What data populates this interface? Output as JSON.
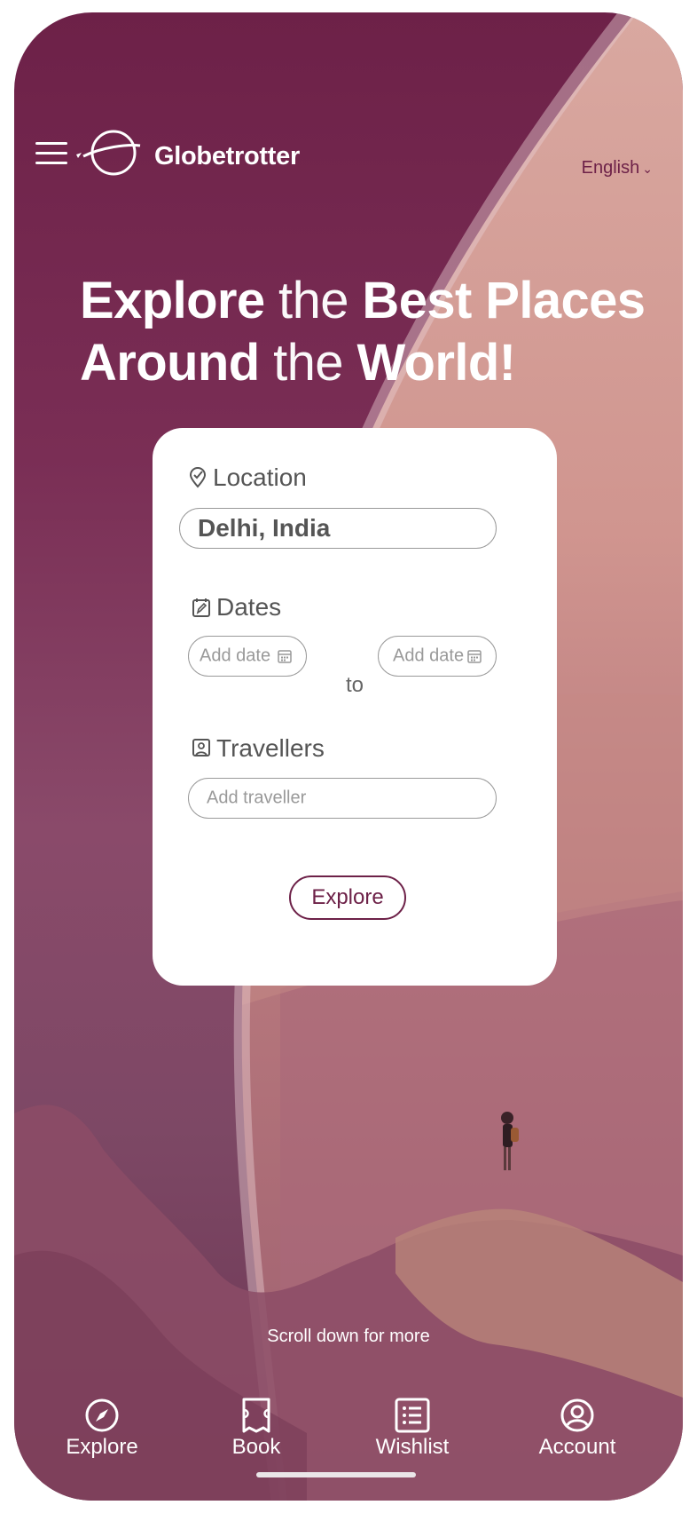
{
  "app": {
    "brand": "Globetrotter",
    "language": "English"
  },
  "hero": {
    "w1": "Explore",
    "w2": " the ",
    "w3": "Best Places",
    "w4": "Around",
    "w5": " the ",
    "w6": "World!"
  },
  "form": {
    "location_label": "Location",
    "location_value": "Delhi, India",
    "dates_label": "Dates",
    "date_from_placeholder": "Add date",
    "date_separator": "to",
    "date_to_placeholder": "Add date",
    "travellers_label": "Travellers",
    "travellers_placeholder": "Add traveller",
    "submit_label": "Explore"
  },
  "scroll_hint": "Scroll down for more",
  "nav": {
    "explore": "Explore",
    "book": "Book",
    "wishlist": "Wishlist",
    "account": "Account"
  },
  "colors": {
    "brand": "#6d2148",
    "card": "#ffffff"
  }
}
